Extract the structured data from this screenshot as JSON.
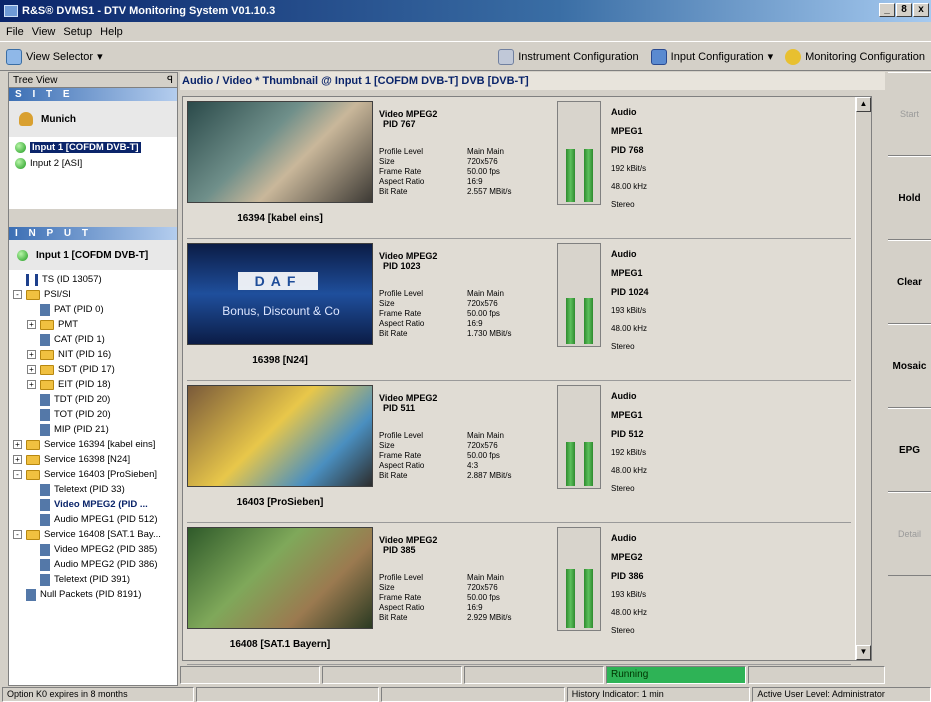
{
  "window": {
    "title": "R&S® DVMS1 - DTV Monitoring System V01.10.3",
    "buttons": [
      "_",
      "8",
      "x"
    ]
  },
  "menu": [
    "File",
    "View",
    "Setup",
    "Help"
  ],
  "toolbar": {
    "view_selector": "View Selector",
    "instrument_config": "Instrument Configuration",
    "input_config": "Input Configuration",
    "monitoring_config": "Monitoring Configuration"
  },
  "tree": {
    "header": "Tree View",
    "pin": "ꟼ",
    "site_label": "S I T E",
    "site_name": "Munich",
    "inputs": [
      {
        "label": "Input 1 [COFDM DVB-T]",
        "selected": true
      },
      {
        "label": "Input 2 [ASI]",
        "selected": false
      }
    ],
    "input_label": "I N P U T",
    "input_name": "Input 1 [COFDM DVB-T]",
    "nodes": [
      {
        "label": "TS (ID 13057)",
        "indent": 0,
        "icon": "ts"
      },
      {
        "label": "PSI/SI",
        "indent": 0,
        "icon": "folder",
        "expand": "-"
      },
      {
        "label": "PAT (PID 0)",
        "indent": 1,
        "icon": "doc"
      },
      {
        "label": "PMT",
        "indent": 1,
        "icon": "folder",
        "expand": "+"
      },
      {
        "label": "CAT (PID 1)",
        "indent": 1,
        "icon": "doc"
      },
      {
        "label": "NIT (PID 16)",
        "indent": 1,
        "icon": "folder",
        "expand": "+"
      },
      {
        "label": "SDT (PID 17)",
        "indent": 1,
        "icon": "folder",
        "expand": "+"
      },
      {
        "label": "EIT (PID 18)",
        "indent": 1,
        "icon": "folder",
        "expand": "+"
      },
      {
        "label": "TDT (PID 20)",
        "indent": 1,
        "icon": "doc"
      },
      {
        "label": "TOT (PID 20)",
        "indent": 1,
        "icon": "doc"
      },
      {
        "label": "MIP (PID 21)",
        "indent": 1,
        "icon": "doc"
      },
      {
        "label": "Service 16394 [kabel eins]",
        "indent": 0,
        "icon": "folder",
        "expand": "+"
      },
      {
        "label": "Service 16398 [N24]",
        "indent": 0,
        "icon": "folder",
        "expand": "+"
      },
      {
        "label": "Service 16403 [ProSieben]",
        "indent": 0,
        "icon": "folder",
        "expand": "-"
      },
      {
        "label": "Teletext (PID 33)",
        "indent": 1,
        "icon": "doc"
      },
      {
        "label": "Video MPEG2 (PID ...",
        "indent": 1,
        "icon": "doc",
        "bold": true
      },
      {
        "label": "Audio MPEG1 (PID 512)",
        "indent": 1,
        "icon": "doc"
      },
      {
        "label": "Service 16408 [SAT.1 Bay...",
        "indent": 0,
        "icon": "folder",
        "expand": "-"
      },
      {
        "label": "Video MPEG2 (PID 385)",
        "indent": 1,
        "icon": "doc"
      },
      {
        "label": "Audio MPEG2 (PID 386)",
        "indent": 1,
        "icon": "doc"
      },
      {
        "label": "Teletext (PID 391)",
        "indent": 1,
        "icon": "doc"
      },
      {
        "label": "Null Packets (PID 8191)",
        "indent": 0,
        "icon": "doc"
      }
    ]
  },
  "main": {
    "title": "Audio / Video * Thumbnail @  Input 1 [COFDM DVB-T] DVB [DVB-T]",
    "param_labels": [
      "Profile Level",
      "Size",
      "Frame Rate",
      "Aspect Ratio",
      "Bit Rate"
    ],
    "entries": [
      {
        "caption": "16394 [kabel eins]",
        "video_title": "Video MPEG2",
        "video_pid": "PID 767",
        "values": [
          "Main Main",
          "720x576",
          "50.00 fps",
          "16:9",
          "2.557 MBit/s"
        ],
        "audio_title": "Audio",
        "audio_codec": "MPEG1",
        "audio_pid": "PID 768",
        "audio_values": [
          "192 kBit/s",
          "48.00 kHz",
          "Stereo"
        ],
        "levels": [
          0.52,
          0.52
        ]
      },
      {
        "caption": "16398 [N24]",
        "video_title": "Video MPEG2",
        "video_pid": "PID 1023",
        "values": [
          "Main Main",
          "720x576",
          "50.00 fps",
          "16:9",
          "1.730 MBit/s"
        ],
        "audio_title": "Audio",
        "audio_codec": "MPEG1",
        "audio_pid": "PID 1024",
        "audio_values": [
          "193 kBit/s",
          "48.00 kHz",
          "Stereo"
        ],
        "levels": [
          0.45,
          0.45
        ]
      },
      {
        "caption": "16403 [ProSieben]",
        "video_title": "Video MPEG2",
        "video_pid": "PID 511",
        "values": [
          "Main Main",
          "720x576",
          "50.00 fps",
          "4:3",
          "2.887 MBit/s"
        ],
        "audio_title": "Audio",
        "audio_codec": "MPEG1",
        "audio_pid": "PID 512",
        "audio_values": [
          "192 kBit/s",
          "48.00 kHz",
          "Stereo"
        ],
        "levels": [
          0.43,
          0.43
        ]
      },
      {
        "caption": "16408 [SAT.1 Bayern]",
        "video_title": "Video MPEG2",
        "video_pid": "PID 385",
        "values": [
          "Main Main",
          "720x576",
          "50.00 fps",
          "16:9",
          "2.929 MBit/s"
        ],
        "audio_title": "Audio",
        "audio_codec": "MPEG2",
        "audio_pid": "PID 386",
        "audio_values": [
          "193 kBit/s",
          "48.00 kHz",
          "Stereo"
        ],
        "levels": [
          0.58,
          0.58
        ]
      }
    ],
    "thumb2_logo": "DAF",
    "thumb2_sub": "Bonus, Discount & Co"
  },
  "side_buttons": [
    {
      "label": "Start",
      "enabled": false
    },
    {
      "label": "Hold",
      "enabled": true
    },
    {
      "label": "Clear",
      "enabled": true
    },
    {
      "label": "Mosaic",
      "enabled": true
    },
    {
      "label": "EPG",
      "enabled": true
    },
    {
      "label": "Detail",
      "enabled": false
    }
  ],
  "status_strip": {
    "running": "Running",
    "running_color": "#2eb356"
  },
  "statusbar": {
    "option": "Option K0 expires in 8 months",
    "history": "History Indicator: 1 min",
    "user_level": "Active User Level: Administrator"
  },
  "colors": {
    "titlebar": "#0a246a",
    "meter_green": "#2e8b2e"
  }
}
